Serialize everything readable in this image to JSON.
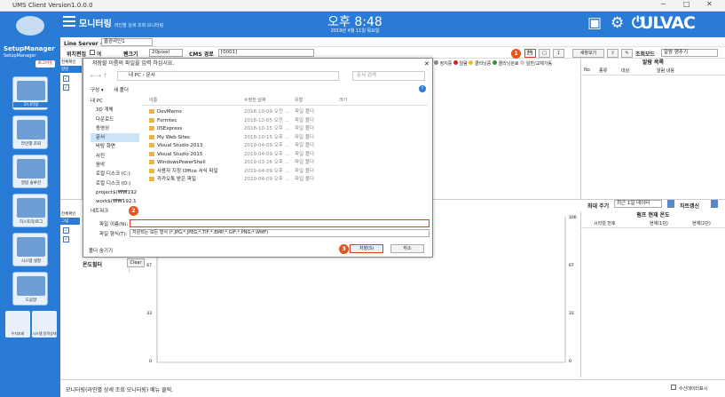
{
  "window": {
    "title": "UMS Client Version1.0.0.0",
    "controls": [
      "─",
      "□",
      "✕"
    ]
  },
  "header": {
    "brand": "모니터링",
    "brand_sub": "라인별 상세 조회 모니터링",
    "clock": "오후 8:48",
    "date": "2019년 4월 11일 목요일",
    "logo": "ULVAC"
  },
  "sidebar": {
    "user": "SetupManager",
    "user_sub": "SetupManager",
    "logout": "로그아웃",
    "items": [
      {
        "label": "모니터링"
      },
      {
        "label": "라인별 조회"
      },
      {
        "label": "알람 솔루션"
      },
      {
        "label": "히스토리/로그"
      },
      {
        "label": "시스템 설정"
      },
      {
        "label": "도움말"
      }
    ],
    "small": [
      {
        "label": "수치조회"
      },
      {
        "label": "시스템 동작상태"
      }
    ]
  },
  "toolbar1": {
    "line_label": "Line Server 선택",
    "line_value": "울광라인1"
  },
  "toolbar2": {
    "label1": "위치편집",
    "opt1": "예",
    "label2": "펜크기",
    "pen": "20pixel",
    "label3": "CMS 경로",
    "cms": "[0001]",
    "btn_new": "새창보기",
    "label4": "조회모드",
    "mode": "알람 행추기"
  },
  "legend": [
    {
      "label": "정지중",
      "color": "#888888"
    },
    {
      "label": "알람",
      "color": "#e02020"
    },
    {
      "label": "클리닝중",
      "color": "#e8c020"
    },
    {
      "label": "클리닝완료",
      "color": "#2a9a2a"
    },
    {
      "label": "일반/교체가동",
      "color": "#cccccc"
    }
  ],
  "dialog": {
    "title": "저장할 이름의 파일을 입력 하십시요.",
    "path": [
      "내 PC",
      "문서"
    ],
    "search_placeholder": "문서 검색",
    "organize": "구성 ▾",
    "new_folder": "새 폴더",
    "nav": [
      "내 PC",
      "3D 개체",
      "다운로드",
      "동영상",
      "문서",
      "바탕 화면",
      "사진",
      "음악",
      "로컬 디스크 (C:)",
      "로컬 디스크 (D:)",
      "project$(₩₩192",
      "work$(₩₩192.1",
      "네트워크"
    ],
    "cols": [
      "이름",
      "수정한 날짜",
      "유형",
      "크기"
    ],
    "files": [
      {
        "name": "DevMemo",
        "date": "2018-10-09 오전 ...",
        "type": "파일 폴더"
      },
      {
        "name": "Formtec",
        "date": "2018-12-05 오전 ...",
        "type": "파일 폴더"
      },
      {
        "name": "IISExpress",
        "date": "2018-10-15 오후 ...",
        "type": "파일 폴더"
      },
      {
        "name": "My Web Sites",
        "date": "2018-10-15 오후 ...",
        "type": "파일 폴더"
      },
      {
        "name": "Visual Studio 2013",
        "date": "2019-04-09 오후 ...",
        "type": "파일 폴더"
      },
      {
        "name": "Visual Studio 2015",
        "date": "2019-04-09 오후 ...",
        "type": "파일 폴더"
      },
      {
        "name": "WindowsPowerShell",
        "date": "2019-03-26 오후 ...",
        "type": "파일 폴더"
      },
      {
        "name": "사용자 지정 Office 서식 파일",
        "date": "2019-04-09 오후 ...",
        "type": "파일 폴더"
      },
      {
        "name": "카카오톡 받은 파일",
        "date": "2019-04-09 오후 ...",
        "type": "파일 폴더"
      }
    ],
    "filename_label": "파일 이름(N):",
    "filename_value": "",
    "filetype_label": "파일 형식(T):",
    "filetype_value": "지원되는 모든 형식 (*.JPG;*.JPEG;*.TIF;*.BMP;*.GIF;*.PNG;*.WMF)",
    "hide_folders": "폴더 숨기기",
    "save": "저장(S)",
    "cancel": "취소"
  },
  "markers": [
    "1",
    "2",
    "3"
  ],
  "left_panel": {
    "header_a": "전체확인",
    "tab": "알린",
    "header_b": "전체확인",
    "tab_b": "그림",
    "filter_label": "온도필터",
    "clear": "Clear"
  },
  "alarm_panel": {
    "title": "알람 목록",
    "cols": [
      "No",
      "종류",
      "대상",
      "알람 내용"
    ]
  },
  "bottom_right": {
    "period_label": "최대 주기",
    "period_value": "최근 1일 데이터",
    "refresh": "차트갱신",
    "title": "펌프 현재 온도",
    "cols": [
      "시리얼 번호",
      "현재(1단)",
      "현재(2단)"
    ]
  },
  "chart": {
    "y_left": [
      "",
      "67",
      "33",
      "0"
    ],
    "y_right": [
      "100",
      "67",
      "33",
      "0"
    ]
  },
  "status": {
    "message": "모니터링(라인별 상세 조회 모니터링) 메뉴 클릭.",
    "checkbox": "수신데이터표시"
  }
}
